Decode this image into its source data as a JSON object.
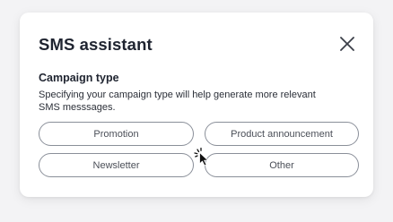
{
  "dialog": {
    "title": "SMS assistant",
    "close_icon": "close-icon"
  },
  "campaign": {
    "heading": "Campaign type",
    "description_line1": "Specifying your campaign type will help generate more relevant",
    "description_line2": "SMS messsages."
  },
  "options": [
    {
      "label": "Promotion"
    },
    {
      "label": "Product announcement"
    },
    {
      "label": "Newsletter"
    },
    {
      "label": "Other"
    }
  ],
  "colors": {
    "text": "#1f2430",
    "border": "#8a8f99",
    "background": "#f3f3f5",
    "card": "#ffffff"
  },
  "cursor_icon": "click-pointer-icon"
}
